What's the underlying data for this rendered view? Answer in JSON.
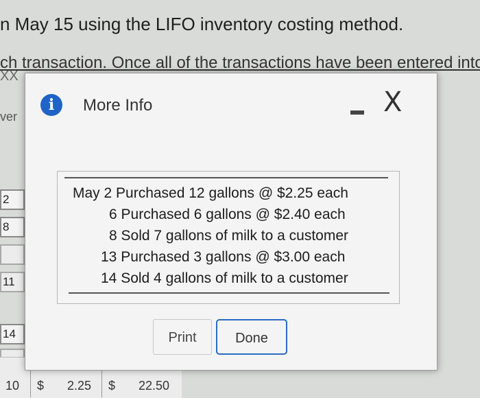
{
  "background": {
    "line1": "n May 15 using the LIFO inventory costing method.",
    "line2": "ch transaction. Once all of the transactions have been entered into th",
    "xx": "XX",
    "ver": "ver",
    "cells": [
      "2",
      "8",
      "11",
      "14"
    ],
    "bottom_row": [
      "10",
      "$",
      "2.25",
      "$",
      "22.50"
    ]
  },
  "dialog": {
    "title": "More Info",
    "info_icon_glyph": "i",
    "minimize_glyph": "-",
    "close_glyph": "X",
    "transactions": [
      "May 2 Purchased 12 gallons @ $2.25 each",
      "6 Purchased 6 gallons @ $2.40 each",
      "8 Sold 7 gallons of milk to a customer",
      "13 Purchased 3 gallons @ $3.00 each",
      "14 Sold 4 gallons of milk to a customer"
    ],
    "print_label": "Print",
    "done_label": "Done"
  }
}
